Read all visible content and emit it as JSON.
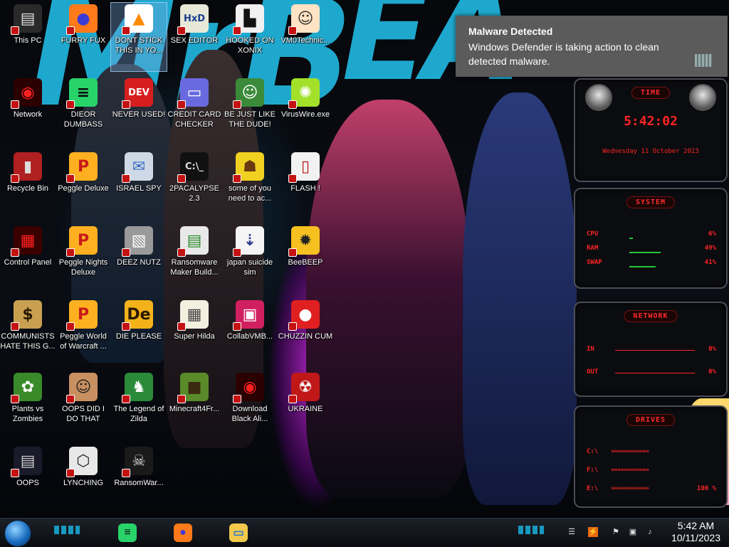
{
  "desktop": {
    "icons": [
      {
        "label": "This PC",
        "glyph": "▤",
        "bg": "#2a2a2a",
        "fg": "#ddd"
      },
      {
        "label": "FURRY FUX",
        "glyph": "●",
        "bg": "#ff7a1a",
        "fg": "#3b3bd6"
      },
      {
        "label": "DONT STICK THIS IN YO...",
        "glyph": "▲",
        "bg": "#ffffff",
        "fg": "#ff8a00"
      },
      {
        "label": "SEX EDITOR",
        "glyph": "HxD",
        "bg": "#e8e8d8",
        "fg": "#1a3f8f"
      },
      {
        "label": "HOOKED ON XONIX",
        "glyph": "▙",
        "bg": "#f0f0f0",
        "fg": "#111"
      },
      {
        "label": "VM0Technic...",
        "glyph": "☺",
        "bg": "#ffe3c4",
        "fg": "#333"
      },
      {
        "label": "Network",
        "glyph": "◉",
        "bg": "#2a0000",
        "fg": "#ff2020"
      },
      {
        "label": "DIEOR DUMBASS",
        "glyph": "≡",
        "bg": "#28d36a",
        "fg": "#0b0b0b"
      },
      {
        "label": "NEVER USED!",
        "glyph": "DEV",
        "bg": "#d61e1e",
        "fg": "#fff"
      },
      {
        "label": "CREDIT CARD CHECKER",
        "glyph": "▭",
        "bg": "#6a6ae0",
        "fg": "#fff"
      },
      {
        "label": "BE JUST LIKE THE DUDE!",
        "glyph": "☺",
        "bg": "#3a8a3a",
        "fg": "#fff"
      },
      {
        "label": "VirusWire.exe",
        "glyph": "✺",
        "bg": "#a2e02a",
        "fg": "#fff"
      },
      {
        "label": "Recycle Bin",
        "glyph": "▮",
        "bg": "#b02020",
        "fg": "#ddd"
      },
      {
        "label": "Peggle Deluxe",
        "glyph": "P",
        "bg": "#ffb020",
        "fg": "#c81a1a"
      },
      {
        "label": "ISRAEL SPY",
        "glyph": "✉",
        "bg": "#cfd8e6",
        "fg": "#3a6fc2"
      },
      {
        "label": "2PACALYPSE 2.3",
        "glyph": "C:\\_",
        "bg": "#111",
        "fg": "#ddd"
      },
      {
        "label": "some of you need to ac...",
        "glyph": "☗",
        "bg": "#f0d020",
        "fg": "#6a3a10"
      },
      {
        "label": "FLASH !",
        "glyph": "▯",
        "bg": "#f2f2f2",
        "fg": "#c01010"
      },
      {
        "label": "Control Panel",
        "glyph": "▦",
        "bg": "#3a0000",
        "fg": "#ff2020"
      },
      {
        "label": "Peggle Nights Deluxe",
        "glyph": "P",
        "bg": "#ffb020",
        "fg": "#c81a1a"
      },
      {
        "label": "DEEZ NUTZ",
        "glyph": "▧",
        "bg": "#9a9a9a",
        "fg": "#fff"
      },
      {
        "label": "Ransomware Maker Build...",
        "glyph": "▤",
        "bg": "#e8e8e8",
        "fg": "#2a8a2a"
      },
      {
        "label": "japan suicide sim",
        "glyph": "⇣",
        "bg": "#f5f5f5",
        "fg": "#2a3a8a"
      },
      {
        "label": "BeeBEEP",
        "glyph": "✹",
        "bg": "#f5c020",
        "fg": "#222"
      },
      {
        "label": "COMMUNISTS HATE THIS G...",
        "glyph": "$",
        "bg": "#c8a050",
        "fg": "#2a1a00"
      },
      {
        "label": "Peggle World of Warcraft ...",
        "glyph": "P",
        "bg": "#ffb020",
        "fg": "#c81a1a"
      },
      {
        "label": "DIE PLEASE",
        "glyph": "De",
        "bg": "#f3b21a",
        "fg": "#2a1a00"
      },
      {
        "label": "Super Hilda",
        "glyph": "▦",
        "bg": "#f4f0e0",
        "fg": "#444"
      },
      {
        "label": "CollabVMB...",
        "glyph": "▣",
        "bg": "#d02060",
        "fg": "#fff"
      },
      {
        "label": "CHUZZIN CUM",
        "glyph": "●",
        "bg": "#e02020",
        "fg": "#fff"
      },
      {
        "label": "Plants vs Zombies",
        "glyph": "✿",
        "bg": "#3a8a2a",
        "fg": "#fff"
      },
      {
        "label": "OOPS DID I DO THAT",
        "glyph": "☺",
        "bg": "#c89060",
        "fg": "#222"
      },
      {
        "label": "The Legend of Zilda",
        "glyph": "♞",
        "bg": "#2a8a3a",
        "fg": "#fff"
      },
      {
        "label": "Minecraft4Fr...",
        "glyph": "■",
        "bg": "#5a8a2a",
        "fg": "#3a2a10"
      },
      {
        "label": "Download Black Ali...",
        "glyph": "◉",
        "bg": "#2a0000",
        "fg": "#ff2020"
      },
      {
        "label": "UKRAINE",
        "glyph": "☢",
        "bg": "#c01818",
        "fg": "#fff"
      },
      {
        "label": "OOPS",
        "glyph": "▤",
        "bg": "#1a1a2a",
        "fg": "#ccc"
      },
      {
        "label": "LYNCHING",
        "glyph": "⬡",
        "bg": "#e8e8e8",
        "fg": "#222"
      },
      {
        "label": "RansomWar...",
        "glyph": "☠",
        "bg": "#1a1a1a",
        "fg": "#ddd"
      }
    ]
  },
  "notification": {
    "title": "Malware Detected",
    "message": "Windows Defender is taking action to clean detected malware."
  },
  "gadgets": {
    "time": {
      "title": "TIME",
      "clock": "5:42:02",
      "date": "Wednesday 11 October 2023"
    },
    "system": {
      "title": "SYSTEM",
      "rows": [
        {
          "label": "CPU",
          "value": "6%",
          "fill": 0.06
        },
        {
          "label": "RAM",
          "value": "49%",
          "fill": 0.49
        },
        {
          "label": "SWAP",
          "value": "41%",
          "fill": 0.41
        }
      ]
    },
    "network": {
      "title": "NETWORK",
      "rows": [
        {
          "label": "IN",
          "value": "0%"
        },
        {
          "label": "OUT",
          "value": "0%"
        }
      ]
    },
    "drives": {
      "title": "DRIVES",
      "rows": [
        {
          "label": "C:\\",
          "value": ""
        },
        {
          "label": "F:\\",
          "value": ""
        },
        {
          "label": "E:\\",
          "value": "100 %"
        }
      ]
    }
  },
  "taskbar": {
    "apps": [
      {
        "name": "dieor",
        "glyph": "≡",
        "bg": "#28d36a",
        "fg": "#0b0b0b"
      },
      {
        "name": "firefox",
        "glyph": "●",
        "bg": "#ff7a1a",
        "fg": "#3b3bd6"
      },
      {
        "name": "explorer",
        "glyph": "▭",
        "bg": "#f2c94c",
        "fg": "#2a7ad6"
      }
    ],
    "clock": {
      "time": "5:42 AM",
      "date": "10/11/2023"
    }
  },
  "colors": {
    "accent": "#22b6df",
    "gadget_red": "#ff2424",
    "toast_bg": "#5b5b5b"
  }
}
